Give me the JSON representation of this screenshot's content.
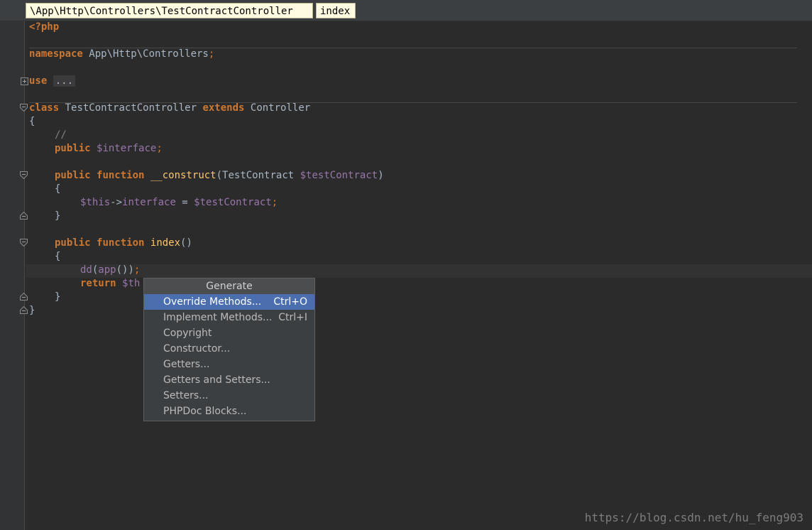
{
  "breadcrumb": {
    "path": "\\App\\Http\\Controllers\\TestContractController",
    "method": "index"
  },
  "code": {
    "l1": "<?php",
    "l3_kw": "namespace",
    "l3_rest": " App\\Http\\Controllers",
    "l3_semi": ";",
    "l5_kw": "use",
    "l5_fold": "...",
    "l7_kw1": "class",
    "l7_name": " TestContractController ",
    "l7_kw2": "extends",
    "l7_parent": " Controller",
    "l8": "{",
    "l9": "//",
    "l10_kw": "public",
    "l10_var": "$interface",
    "l10_semi": ";",
    "l12_kw1": "public",
    "l12_kw2": "function",
    "l12_fn": "__construct",
    "l12_open": "(TestContract ",
    "l12_var": "$testContract",
    "l12_close": ")",
    "l13": "{",
    "l14_var1": "$this",
    "l14_arrow": "->",
    "l14_prop": "interface",
    "l14_eq": " = ",
    "l14_var2": "$testContract",
    "l14_semi": ";",
    "l15": "}",
    "l17_kw1": "public",
    "l17_kw2": "function",
    "l17_fn": "index",
    "l17_parens": "()",
    "l18": "{",
    "l19_dd": "dd",
    "l19_open": "(",
    "l19_app": "app",
    "l19_close": "())",
    "l19_semi": ";",
    "l20_kw": "return",
    "l20_var": "$th",
    "l21": "}",
    "l22": "}"
  },
  "popup": {
    "title": "Generate",
    "items": [
      {
        "label": "Override Methods...",
        "shortcut": "Ctrl+O",
        "selected": true
      },
      {
        "label": "Implement Methods...",
        "shortcut": "Ctrl+I"
      },
      {
        "label": "Copyright"
      },
      {
        "label": "Constructor..."
      },
      {
        "label": "Getters..."
      },
      {
        "label": "Getters and Setters..."
      },
      {
        "label": "Setters..."
      },
      {
        "label": "PHPDoc Blocks..."
      }
    ]
  },
  "watermark": "https://blog.csdn.net/hu_feng903"
}
